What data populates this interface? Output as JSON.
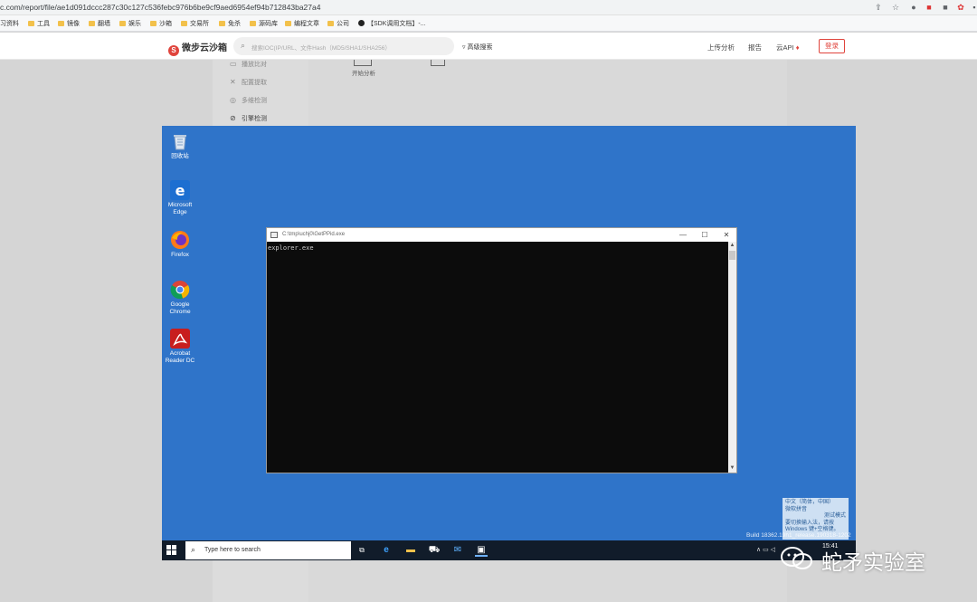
{
  "browser": {
    "url": "c.com/report/file/ae1d091dccc287c30c127c536febc976b6be9cf9aed6954ef94b712843ba27a4",
    "bookmarks": [
      "习资料",
      "工具",
      "镜像",
      "翻墙",
      "娱乐",
      "沙箱",
      "交易所",
      "免杀",
      "源码库",
      "编程文章",
      "公司",
      "【SDK调用文档】-..."
    ]
  },
  "site": {
    "logo": "微步云沙箱",
    "search_placeholder": "搜索IOC(IP/URL、文件Hash（MD5/SHA1/SHA256）",
    "advanced_search": "高级搜索",
    "nav": [
      "上传分析",
      "报告",
      "云API"
    ],
    "login": "登录",
    "sidebar": [
      "播放比对",
      "配置提取",
      "多维检测",
      "引擎检测"
    ],
    "start_analysis": "开始分析"
  },
  "vm": {
    "desktop_icons": [
      {
        "label": "回收站",
        "icon": "recycle-bin-icon"
      },
      {
        "label": "Microsoft Edge",
        "icon": "edge-icon"
      },
      {
        "label": "Firefox",
        "icon": "firefox-icon"
      },
      {
        "label": "Google Chrome",
        "icon": "chrome-icon"
      },
      {
        "label": "Acrobat Reader DC",
        "icon": "acrobat-icon"
      }
    ],
    "console": {
      "title": "C:\\tmp\\uchj0\\GetPPid.exe",
      "output": "explorer.exe"
    },
    "ime_popup": {
      "line1": "中文（简体，中国）",
      "line2": "微软拼音",
      "line3": "测试模式",
      "line4": "要切换输入法，请按 Windows 键+空格键。"
    },
    "build_text": "Build 18362.19h1_release.190318-1202",
    "taskbar": {
      "search_placeholder": "Type here to search",
      "clock_time": "15:41"
    }
  },
  "watermark": "蛇矛实验室",
  "colors": {
    "desktop": "#2f74c9",
    "taskbar": "#111c2a",
    "accent": "#e0443c"
  }
}
